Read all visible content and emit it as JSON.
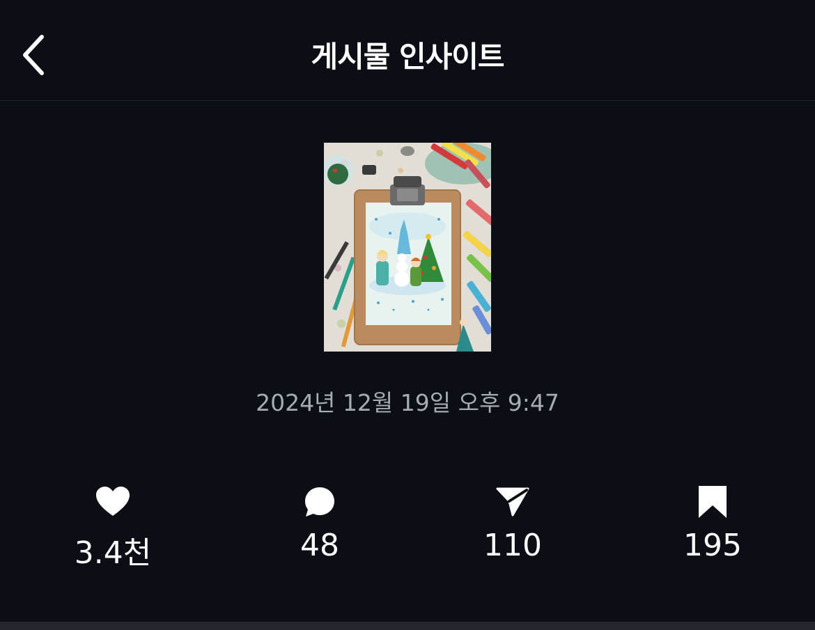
{
  "header": {
    "title": "게시물 인사이트",
    "back_icon": "chevron-left-icon"
  },
  "post": {
    "thumbnail_icon": "post-thumbnail-image",
    "timestamp": "2024년 12월 19일 오후 9:47"
  },
  "stats": [
    {
      "icon": "heart-icon",
      "value": "3.4천"
    },
    {
      "icon": "comment-icon",
      "value": "48"
    },
    {
      "icon": "share-icon",
      "value": "110"
    },
    {
      "icon": "bookmark-icon",
      "value": "195"
    }
  ],
  "colors": {
    "background": "#0b0e15",
    "text": "#ffffff",
    "secondary_text": "#a7abb4",
    "divider": "#232733"
  }
}
